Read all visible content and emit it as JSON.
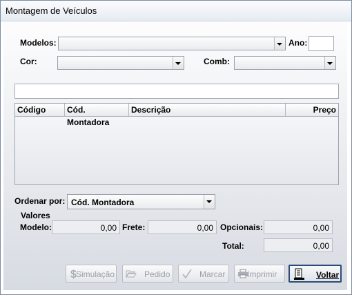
{
  "window": {
    "title": "Montagem de Veículos"
  },
  "filters": {
    "modelos_label": "Modelos:",
    "modelos_value": "",
    "ano_label": "Ano:",
    "ano_value": "",
    "cor_label": "Cor:",
    "cor_value": "",
    "comb_label": "Comb:",
    "comb_value": ""
  },
  "search": {
    "value": ""
  },
  "table": {
    "columns": [
      "Código",
      "Cód. Montadora",
      "Descrição",
      "Preço"
    ],
    "rows": []
  },
  "sort": {
    "label": "Ordenar por:",
    "value": "Cód. Montadora"
  },
  "valores": {
    "group_label": "Valores",
    "modelo_label": "Modelo:",
    "modelo_value": "0,00",
    "frete_label": "Frete:",
    "frete_value": "0,00",
    "opcionais_label": "Opcionais:",
    "opcionais_value": "0,00",
    "total_label": "Total:",
    "total_value": "0,00"
  },
  "buttons": {
    "simulacao": "Simulação",
    "pedido": "Pedido",
    "marcar": "Marcar",
    "imprimir": "Imprimir",
    "voltar": "Voltar"
  },
  "icons": {
    "simulacao": "dollar-icon",
    "pedido": "folder-open-icon",
    "marcar": "checkmark-icon",
    "imprimir": "printer-icon",
    "voltar": "exit-door-icon"
  },
  "colors": {
    "accent_border": "#2d4b78",
    "disabled_text": "#9aa0a8"
  }
}
